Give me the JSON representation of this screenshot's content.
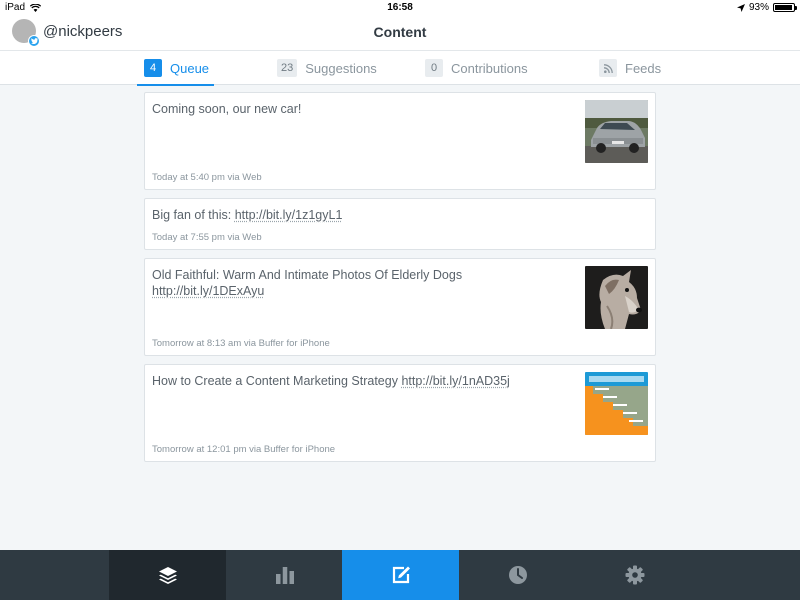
{
  "status_bar": {
    "device": "iPad",
    "time": "16:58",
    "battery": "93%",
    "battery_level": 0.93
  },
  "header": {
    "username": "@nickpeers",
    "title": "Content"
  },
  "tabs": [
    {
      "count": "4",
      "label": "Queue",
      "active": true
    },
    {
      "count": "23",
      "label": "Suggestions",
      "active": false
    },
    {
      "count": "0",
      "label": "Contributions",
      "active": false
    },
    {
      "label": "Feeds",
      "icon": "rss-icon",
      "active": false
    }
  ],
  "posts": [
    {
      "text": "Coming soon, our new car!",
      "link": "",
      "meta": "Today at 5:40 pm via Web",
      "thumbnail": "car-photo"
    },
    {
      "text": "Big fan of this: ",
      "link": "http://bit.ly/1z1gyL1",
      "meta": "Today at 7:55 pm via Web"
    },
    {
      "text": "Old Faithful: Warm And Intimate Photos Of Elderly Dogs ",
      "link": "http://bit.ly/1DExAyu",
      "meta": "Tomorrow at 8:13 am via Buffer for iPhone",
      "thumbnail": "dog-photo"
    },
    {
      "text": "How to Create a Content Marketing Strategy ",
      "link": "http://bit.ly/1nAD35j",
      "meta": "Tomorrow at 12:01 pm via Buffer for iPhone",
      "thumbnail": "content-strategy-graphic"
    }
  ],
  "bottom_nav": [
    {
      "icon": "layers-icon",
      "active": true
    },
    {
      "icon": "bar-chart-icon"
    },
    {
      "icon": "compose-icon",
      "highlight": true
    },
    {
      "icon": "clock-icon"
    },
    {
      "icon": "gear-icon"
    }
  ],
  "colors": {
    "accent": "#168eea",
    "nav_bg": "#2f3a42",
    "nav_active": "#20282e"
  }
}
